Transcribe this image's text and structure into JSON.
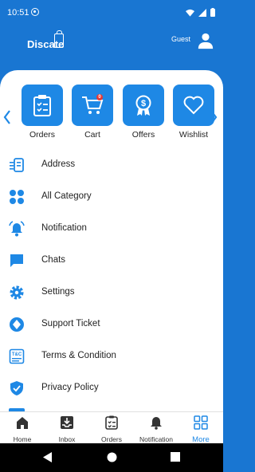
{
  "status": {
    "time": "10:51"
  },
  "header": {
    "logo": "Discate",
    "user_label": "Guest"
  },
  "tiles": [
    {
      "label": "Orders",
      "icon": "clipboard-icon"
    },
    {
      "label": "Cart",
      "icon": "cart-icon",
      "badge": "0"
    },
    {
      "label": "Offers",
      "icon": "offer-badge-icon"
    },
    {
      "label": "Wishlist",
      "icon": "heart-icon"
    }
  ],
  "menu": [
    {
      "label": "Address",
      "icon": "address-icon"
    },
    {
      "label": "All Category",
      "icon": "grid-icon"
    },
    {
      "label": "Notification",
      "icon": "bell-icon"
    },
    {
      "label": "Chats",
      "icon": "chat-icon"
    },
    {
      "label": "Settings",
      "icon": "gear-icon"
    },
    {
      "label": "Support Ticket",
      "icon": "support-icon"
    },
    {
      "label": "Terms & Condition",
      "icon": "terms-icon"
    },
    {
      "label": "Privacy Policy",
      "icon": "shield-icon"
    }
  ],
  "bottom_nav": [
    {
      "label": "Home",
      "icon": "home-icon"
    },
    {
      "label": "Inbox",
      "icon": "inbox-icon"
    },
    {
      "label": "Orders",
      "icon": "orders-icon"
    },
    {
      "label": "Notification",
      "icon": "bell-icon"
    },
    {
      "label": "More",
      "icon": "more-grid-icon",
      "active": true
    }
  ],
  "colors": {
    "primary": "#1976d2",
    "tile": "#1e88e5",
    "active": "#1e88e5"
  }
}
